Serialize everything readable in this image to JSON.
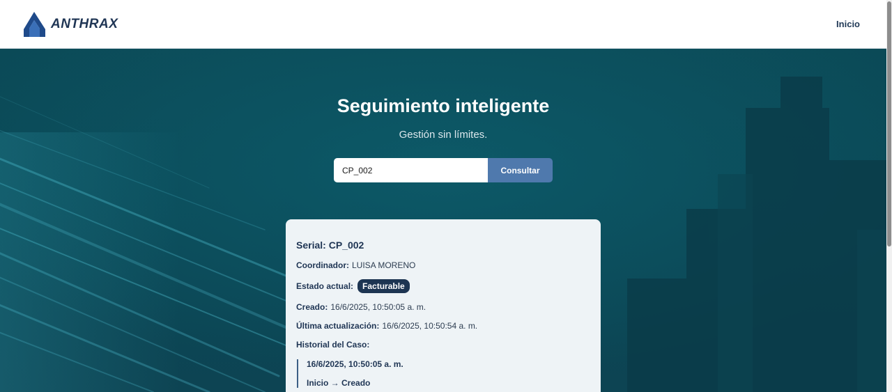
{
  "header": {
    "brand_name": "ANTHRAX",
    "nav": {
      "home_label": "Inicio"
    }
  },
  "hero": {
    "title": "Seguimiento inteligente",
    "subtitle": "Gestión sin límites."
  },
  "search": {
    "value": "CP_002",
    "button_label": "Consultar"
  },
  "result": {
    "serial_label": "Serial:",
    "serial_value": "CP_002",
    "coordinator_label": "Coordinador:",
    "coordinator_value": "LUISA MORENO",
    "status_label": "Estado actual:",
    "status_value": "Facturable",
    "created_label": "Creado:",
    "created_value": "16/6/2025, 10:50:05 a. m.",
    "updated_label": "Última actualización:",
    "updated_value": "16/6/2025, 10:50:54 a. m.",
    "history_title": "Historial del Caso:",
    "history": [
      {
        "date": "16/6/2025, 10:50:05 a. m.",
        "change": "Inicio → Creado"
      }
    ]
  },
  "colors": {
    "brand_navy": "#1f3554",
    "accent_button": "#4f79ad",
    "hero_teal": "#0b4a57",
    "badge_bg": "#1d3552"
  }
}
